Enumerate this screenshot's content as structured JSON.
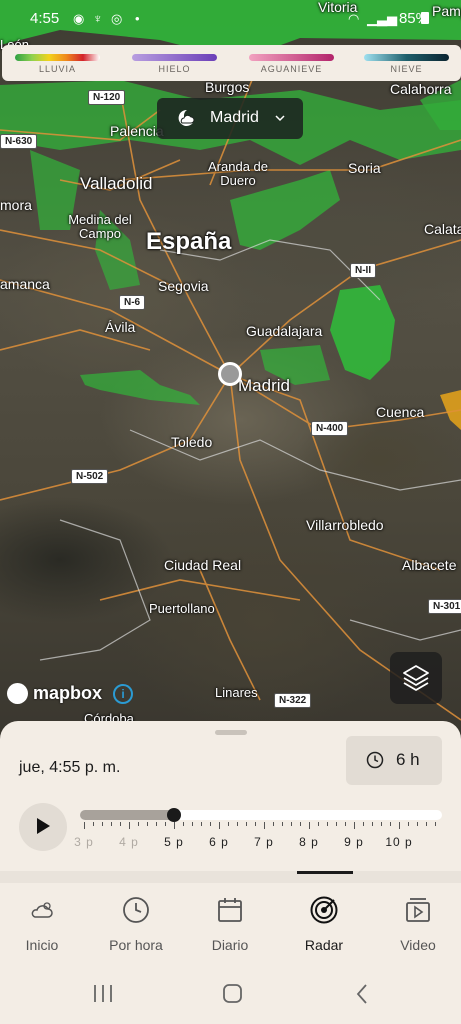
{
  "status": {
    "time": "4:55",
    "battery": "85%"
  },
  "legend": [
    {
      "label": "LLUVIA",
      "gradient": "linear-gradient(90deg,#2ea043,#8fd14f,#f3d21b,#f08a1c,#d3222a,#fff)"
    },
    {
      "label": "HIELO",
      "gradient": "linear-gradient(90deg,#b89ee0,#6b3fb8)"
    },
    {
      "label": "AGUANIEVE",
      "gradient": "linear-gradient(90deg,#f2a2c0,#b3246b)"
    },
    {
      "label": "NIEVE",
      "gradient": "linear-gradient(90deg,#9fe1f0,#1f5f6b,#0b2430)"
    }
  ],
  "location": {
    "name": "Madrid"
  },
  "map": {
    "country": "España",
    "places": [
      "Vitoria",
      "Pamp",
      "León",
      "Burgos",
      "Calahorra",
      "Palencia",
      "Soria",
      "Valladolid",
      "Aranda de Duero",
      "mora",
      "Medina del Campo",
      "Calata",
      "amanca",
      "Segovia",
      "Ávila",
      "Guadalajara",
      "Madrid",
      "Cuenca",
      "Toledo",
      "Villarrobledo",
      "Ciudad Real",
      "Albacete",
      "Puertollano",
      "Linares",
      "Córdoba"
    ],
    "roads": [
      "N-120",
      "N-630",
      "N-II",
      "N-6",
      "N-400",
      "N-502",
      "N-301",
      "N-322"
    ],
    "attribution": "mapbox"
  },
  "sheet": {
    "datetime": "jue, 4:55 p. m.",
    "duration": "6 h",
    "hours": [
      "3 p",
      "4 p",
      "5 p",
      "6 p",
      "7 p",
      "8 p",
      "9 p",
      "10 p"
    ],
    "progress": 0.25
  },
  "nav": [
    {
      "label": "Inicio",
      "icon": "cloud-sun-icon"
    },
    {
      "label": "Por hora",
      "icon": "clock-icon"
    },
    {
      "label": "Diario",
      "icon": "calendar-icon"
    },
    {
      "label": "Radar",
      "icon": "radar-icon",
      "active": true
    },
    {
      "label": "Video",
      "icon": "video-icon"
    }
  ]
}
